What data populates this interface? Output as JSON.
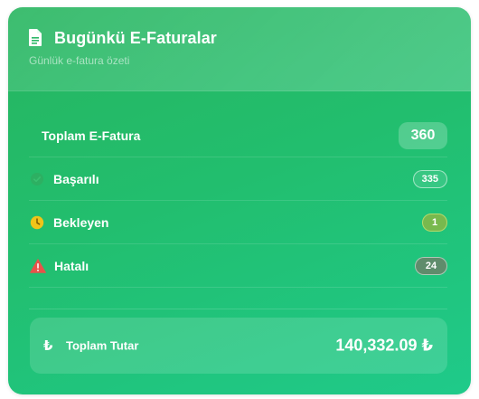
{
  "header": {
    "title": "Bugünkü E-Faturalar",
    "subtitle": "Günlük e-fatura özeti",
    "icon": "document-icon"
  },
  "stats": {
    "total": {
      "label": "Toplam E-Fatura",
      "value": "360"
    },
    "success": {
      "label": "Başarılı",
      "value": "335",
      "icon": "check-circle-icon"
    },
    "pending": {
      "label": "Bekleyen",
      "value": "1",
      "icon": "clock-icon",
      "icon_color": "#f0c419"
    },
    "error": {
      "label": "Hatalı",
      "value": "24",
      "icon": "warning-triangle-icon",
      "icon_color": "#e8534a"
    }
  },
  "summary": {
    "currency_icon": "lira-icon",
    "currency_symbol": "₺",
    "label": "Toplam Tutar",
    "value": "140,332.09 ₺"
  },
  "colors": {
    "card_start": "#27b55f",
    "card_end": "#1fca8a",
    "pending_badge": "#78b94e",
    "error_badge": "#5f8c6c"
  }
}
